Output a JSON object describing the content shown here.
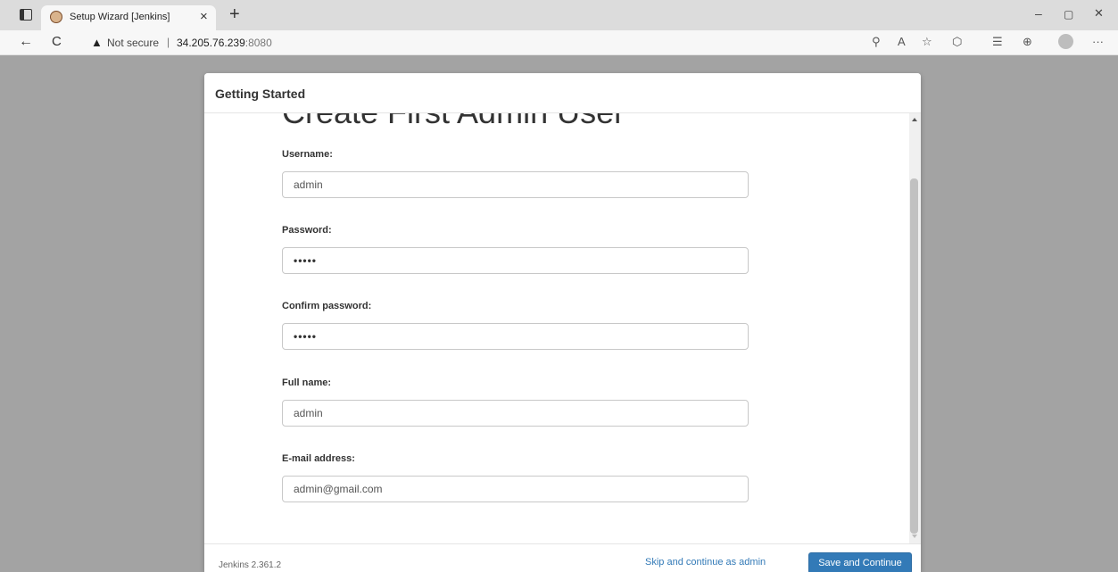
{
  "browser": {
    "tab_title": "Setup Wizard [Jenkins]",
    "tab_close": "×",
    "new_tab": "+",
    "not_secure": "Not secure",
    "separator": "|",
    "url_host": "34.205.76.239",
    "url_port": ":8080",
    "icons": {
      "back": "←",
      "refresh": "C",
      "warning": "▲",
      "key": "⚲",
      "read_aloud": "A",
      "favorite": "☆",
      "extensions": "⬡",
      "favorites_bar": "☰",
      "collections": "⊕",
      "more": "···",
      "minimize": "–",
      "restore": "▢",
      "close": "✕"
    }
  },
  "modal": {
    "title": "Getting Started",
    "heading": "Create First Admin User",
    "fields": [
      {
        "label": "Username:",
        "value": "admin"
      },
      {
        "label": "Password:",
        "value": "•••••"
      },
      {
        "label": "Confirm password:",
        "value": "•••••"
      },
      {
        "label": "Full name:",
        "value": "admin"
      },
      {
        "label": "E-mail address:",
        "value": "admin@gmail.com"
      }
    ],
    "footer": {
      "version": "Jenkins 2.361.2",
      "skip_label": "Skip and continue as admin",
      "save_label": "Save and Continue"
    }
  },
  "colors": {
    "primary_button": "#337ab7",
    "link": "#337ab7",
    "backdrop": "#a3a3a3"
  }
}
